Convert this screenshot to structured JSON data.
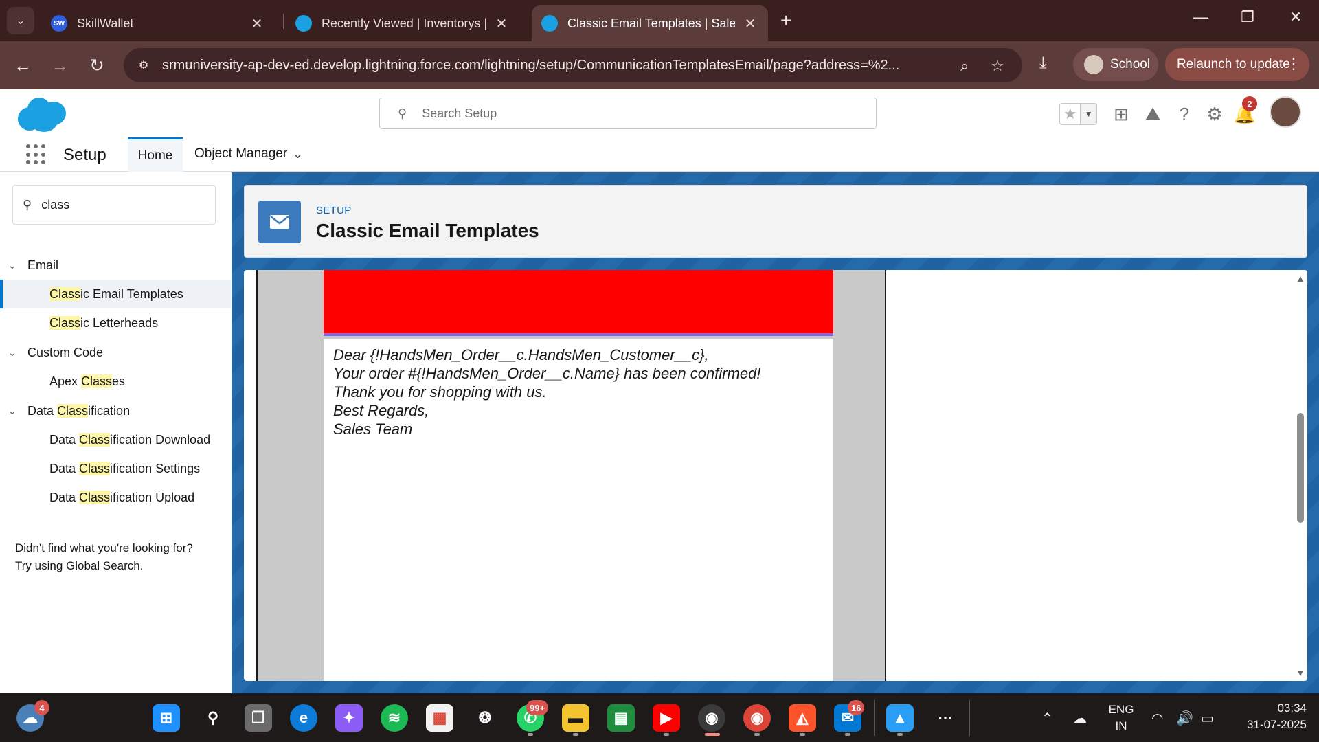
{
  "browser": {
    "tabs": [
      {
        "title": "SkillWallet",
        "favicon_text": "SW",
        "active": false
      },
      {
        "title": "Recently Viewed | Inventorys | S",
        "active": false
      },
      {
        "title": "Classic Email Templates | Salesf",
        "active": true
      }
    ],
    "url": "srmuniversity-ap-dev-ed.develop.lightning.force.com/lightning/setup/CommunicationTemplatesEmail/page?address=%2...",
    "profile_label": "School",
    "relaunch_label": "Relaunch to update"
  },
  "sf_header": {
    "search_placeholder": "Search Setup",
    "notification_count": "2"
  },
  "nav": {
    "app_name": "Setup",
    "tabs": [
      "Home",
      "Object Manager"
    ]
  },
  "sidebar": {
    "quick_find_value": "class",
    "help_line1": "Didn't find what you're looking for?",
    "help_line2": "Try using Global Search."
  },
  "page_header": {
    "eyebrow": "SETUP",
    "title": "Classic Email Templates"
  },
  "email": {
    "lines": [
      "Dear {!HandsMen_Order__c.HandsMen_Customer__c},",
      "Your order #{!HandsMen_Order__c.Name} has been confirmed!",
      "Thank you for shopping with us.",
      "Best Regards,",
      "Sales Team"
    ],
    "letterhead_color": "#ff0000",
    "accent_line_color": "#7b68ee"
  },
  "taskbar": {
    "weather_badge": "4",
    "whatsapp_badge": "99+",
    "outlook_badge": "16",
    "language": "ENG",
    "region": "IN",
    "time": "03:34",
    "date": "31-07-2025"
  }
}
